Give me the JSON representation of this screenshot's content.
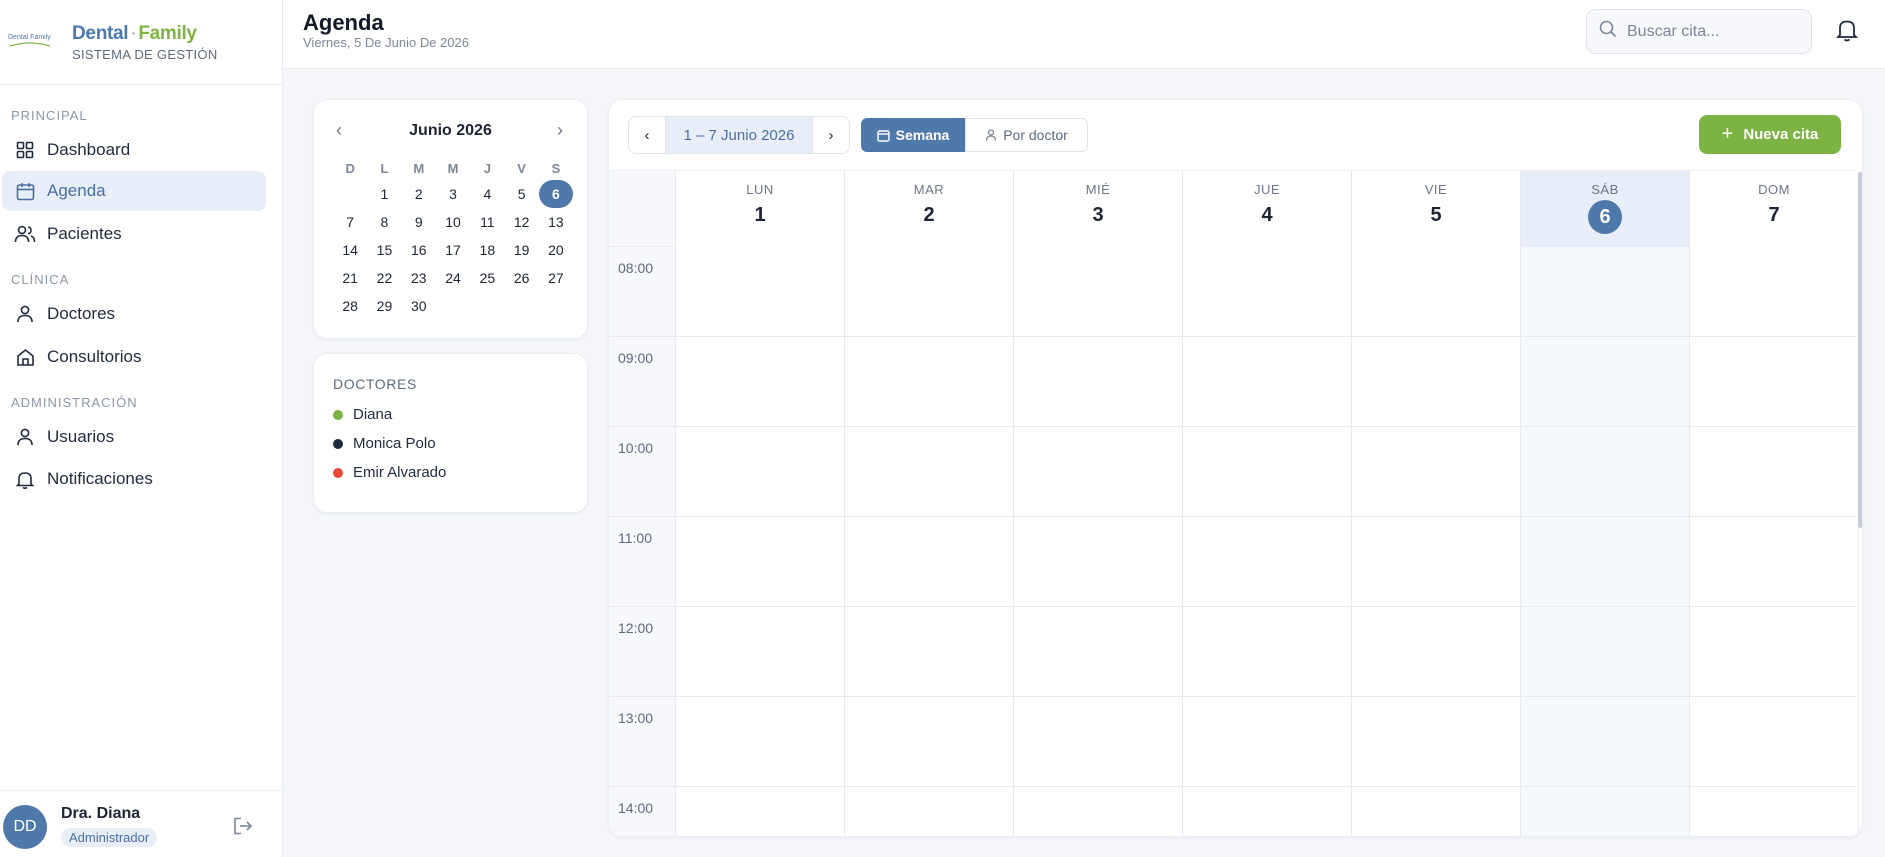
{
  "brand": {
    "logo_text": "Dental Family",
    "name_a": "Dental",
    "sep": "·",
    "name_b": "Family",
    "subtitle": "SISTEMA DE GESTIÓN"
  },
  "nav": {
    "sections": [
      "PRINCIPAL",
      "CLÍNICA",
      "ADMINISTRACIÓN"
    ],
    "items": [
      {
        "label": "Dashboard",
        "icon": "grid-icon",
        "active": false
      },
      {
        "label": "Agenda",
        "icon": "calendar-icon",
        "active": true
      },
      {
        "label": "Pacientes",
        "icon": "users-icon",
        "active": false
      },
      {
        "label": "Doctores",
        "icon": "user-icon",
        "active": false
      },
      {
        "label": "Consultorios",
        "icon": "home-icon",
        "active": false
      },
      {
        "label": "Usuarios",
        "icon": "user-icon",
        "active": false
      },
      {
        "label": "Notificaciones",
        "icon": "bell-icon",
        "active": false
      }
    ]
  },
  "user": {
    "initials": "DD",
    "name": "Dra. Diana",
    "role": "Administrador"
  },
  "header": {
    "title": "Agenda",
    "date": "Viernes, 5 De Junio De 2026"
  },
  "search": {
    "placeholder": "Buscar cita..."
  },
  "mini_calendar": {
    "month": "Junio 2026",
    "weekdays": [
      "D",
      "L",
      "M",
      "M",
      "J",
      "V",
      "S"
    ],
    "days": [
      "1",
      "2",
      "3",
      "4",
      "5",
      "6",
      "7",
      "8",
      "9",
      "10",
      "11",
      "12",
      "13",
      "14",
      "15",
      "16",
      "17",
      "18",
      "19",
      "20",
      "21",
      "22",
      "23",
      "24",
      "25",
      "26",
      "27",
      "28",
      "29",
      "30"
    ],
    "selected": "6",
    "prev": "‹",
    "next": "›"
  },
  "doctors": {
    "title": "DOCTORES",
    "list": [
      {
        "name": "Diana",
        "color": "#7cb342"
      },
      {
        "name": "Monica Polo",
        "color": "#1f2a3c"
      },
      {
        "name": "Emir Alvarado",
        "color": "#e8483a"
      }
    ]
  },
  "toolbar": {
    "prev": "‹",
    "range": "1 – 7 Junio 2026",
    "next": "›",
    "view_week": "Semana",
    "view_doctor": "Por doctor",
    "new_appointment": "Nueva cita",
    "plus": "+"
  },
  "week": {
    "days": [
      {
        "name": "LUN",
        "num": "1",
        "today": false
      },
      {
        "name": "MAR",
        "num": "2",
        "today": false
      },
      {
        "name": "MIÉ",
        "num": "3",
        "today": false
      },
      {
        "name": "JUE",
        "num": "4",
        "today": false
      },
      {
        "name": "VIE",
        "num": "5",
        "today": false
      },
      {
        "name": "SÁB",
        "num": "6",
        "today": true
      },
      {
        "name": "DOM",
        "num": "7",
        "today": false
      }
    ],
    "hours": [
      "08:00",
      "09:00",
      "10:00",
      "11:00",
      "12:00",
      "13:00",
      "14:00"
    ]
  },
  "colors": {
    "accent": "#5079ab",
    "brand_green": "#7cb342"
  }
}
